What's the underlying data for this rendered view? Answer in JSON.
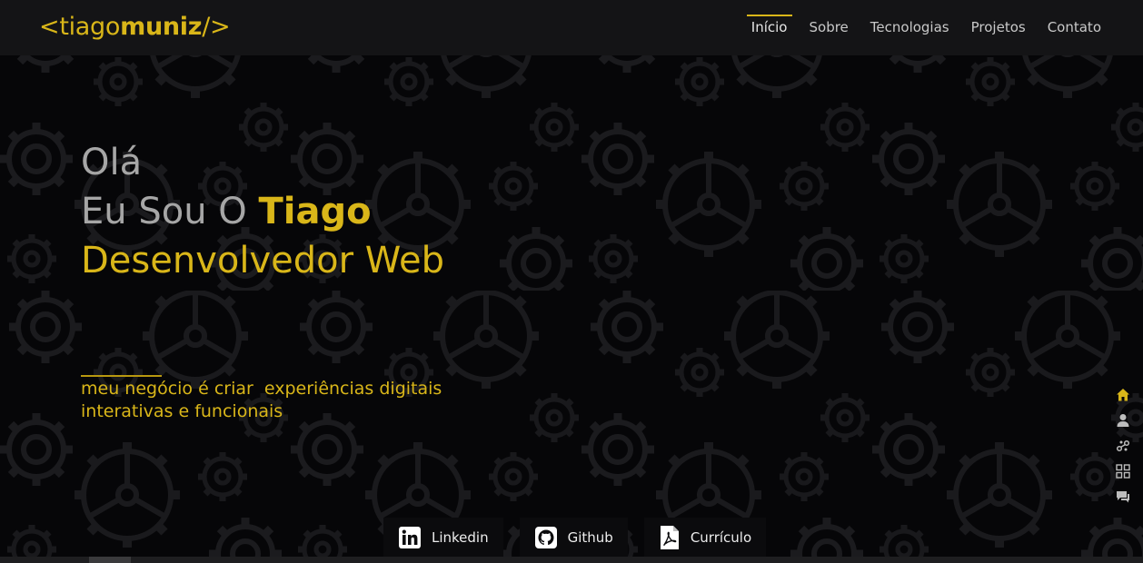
{
  "logo": {
    "open": "<tiago",
    "bold": "muniz",
    "close": "/>"
  },
  "nav": {
    "items": [
      {
        "label": "Início",
        "active": true
      },
      {
        "label": "Sobre",
        "active": false
      },
      {
        "label": "Tecnologias",
        "active": false
      },
      {
        "label": "Projetos",
        "active": false
      },
      {
        "label": "Contato",
        "active": false
      }
    ]
  },
  "hero": {
    "greeting": "Olá",
    "intro": "Eu Sou O ",
    "name": "Tiago",
    "role": "Desenvolvedor Web"
  },
  "tagline": {
    "line1": "meu negócio é criar  experiências digitais",
    "line2": "interativas e funcionais"
  },
  "side_nav": {
    "icons": [
      "home-icon",
      "user-icon",
      "tech-icon",
      "grid-icon",
      "chat-icon"
    ]
  },
  "social": {
    "linkedin": "Linkedin",
    "github": "Github",
    "cv": "Currículo"
  },
  "colors": {
    "accent": "#d9b619",
    "background": "#060608",
    "navbar": "#141416",
    "text_muted": "#a6a6a6"
  }
}
